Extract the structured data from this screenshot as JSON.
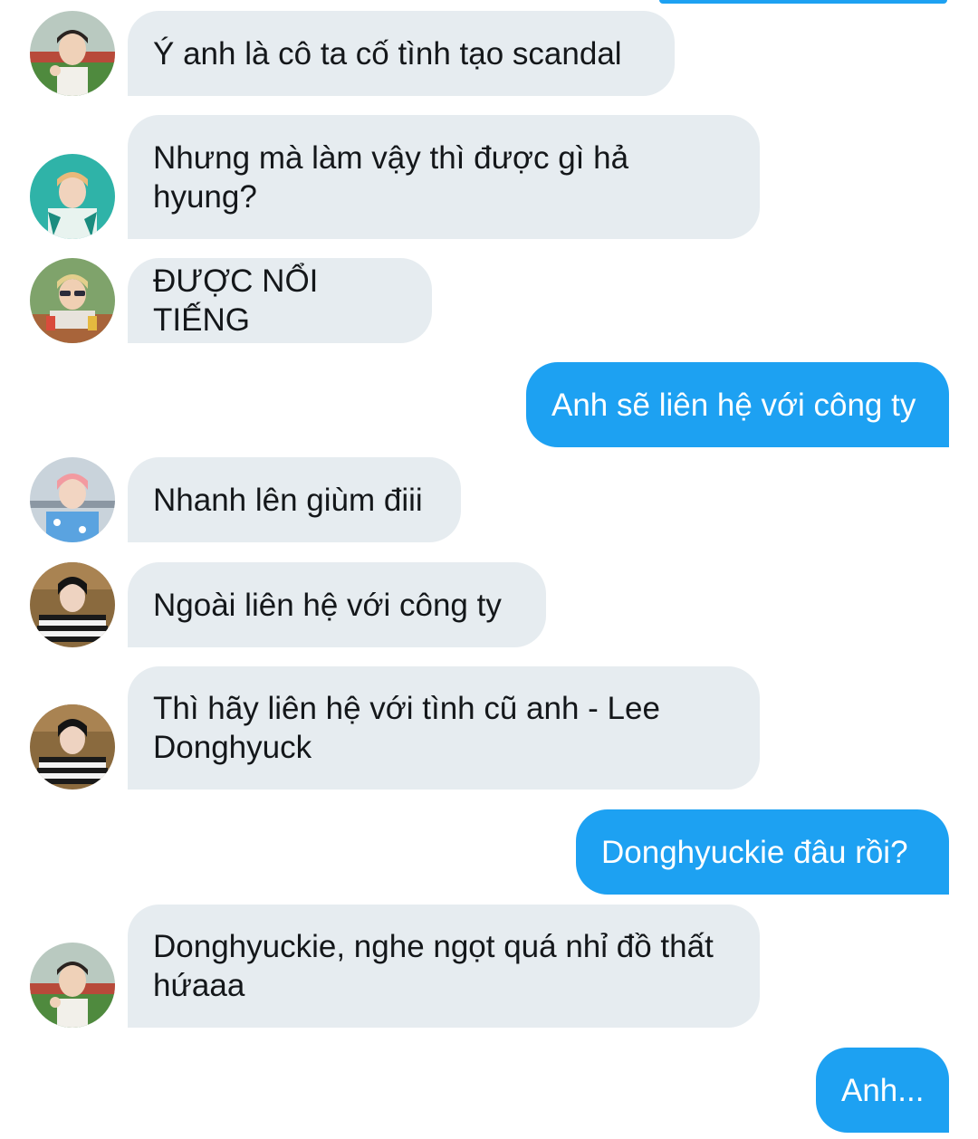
{
  "messages": [
    {
      "side": "in",
      "avatar": "avatar-boy-field",
      "text": "Ý anh là cô ta cố tình tạo scandal"
    },
    {
      "side": "in",
      "avatar": "avatar-boy-teal",
      "text": "Nhưng mà làm vậy thì được gì hả\nhyung?"
    },
    {
      "side": "in",
      "avatar": "avatar-boy-blonde-sunglasses",
      "text": "ĐƯỢC NỔI TIẾNG"
    },
    {
      "side": "out",
      "text": "Anh sẽ liên hệ với công ty"
    },
    {
      "side": "in",
      "avatar": "avatar-boy-pink-hair",
      "text": "Nhanh lên giùm điii"
    },
    {
      "side": "in",
      "avatar": "avatar-boy-striped",
      "text": "Ngoài liên hệ với công ty"
    },
    {
      "side": "in",
      "avatar": "avatar-boy-striped",
      "text": "Thì hãy liên hệ với tình cũ anh - Lee\nDonghyuck"
    },
    {
      "side": "out",
      "text": "Donghyuckie đâu rồi?"
    },
    {
      "side": "in",
      "avatar": "avatar-boy-field",
      "text": "Donghyuckie, nghe ngọt quá nhỉ đồ thất\nhứaaa"
    },
    {
      "side": "out",
      "text": "Anh..."
    }
  ],
  "colors": {
    "incoming_bubble": "#e6ecf0",
    "outgoing_bubble": "#1da1f2",
    "incoming_text": "#14171a",
    "outgoing_text": "#ffffff"
  }
}
